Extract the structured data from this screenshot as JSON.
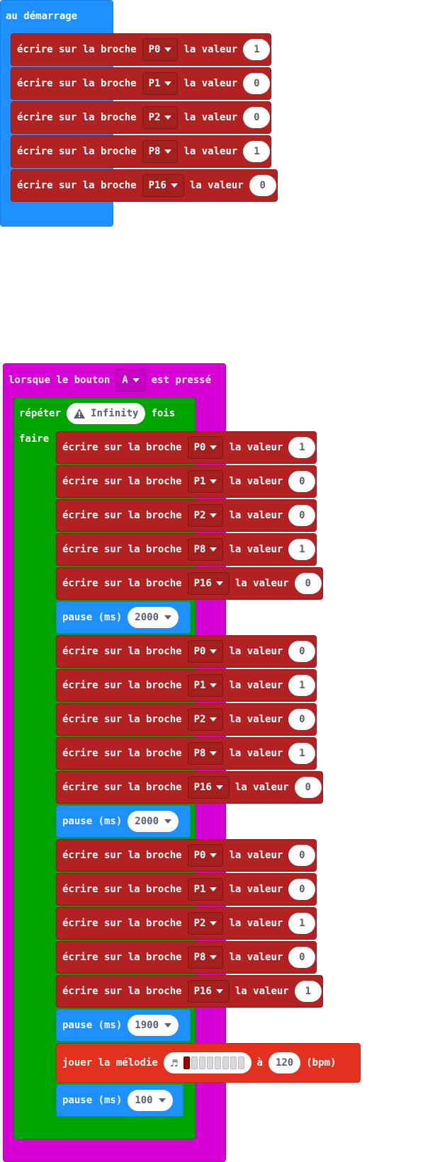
{
  "start_block": {
    "title": "au démarrage",
    "statements": [
      {
        "prefix": "écrire sur la broche",
        "pin": "P0",
        "mid": "la valeur",
        "value": "1"
      },
      {
        "prefix": "écrire sur la broche",
        "pin": "P1",
        "mid": "la valeur",
        "value": "0"
      },
      {
        "prefix": "écrire sur la broche",
        "pin": "P2",
        "mid": "la valeur",
        "value": "0"
      },
      {
        "prefix": "écrire sur la broche",
        "pin": "P8",
        "mid": "la valeur",
        "value": "1"
      },
      {
        "prefix": "écrire sur la broche",
        "pin": "P16",
        "mid": "la valeur",
        "value": "0"
      }
    ]
  },
  "button_block": {
    "prefix": "lorsque le bouton",
    "button": "A",
    "suffix": "est pressé",
    "repeat": {
      "label": "répéter",
      "count": "Infinity",
      "suffix": "fois",
      "do_label": "faire",
      "statements": [
        {
          "prefix": "écrire sur la broche",
          "pin": "P0",
          "mid": "la valeur",
          "value": "1"
        },
        {
          "prefix": "écrire sur la broche",
          "pin": "P1",
          "mid": "la valeur",
          "value": "0"
        },
        {
          "prefix": "écrire sur la broche",
          "pin": "P2",
          "mid": "la valeur",
          "value": "0"
        },
        {
          "prefix": "écrire sur la broche",
          "pin": "P8",
          "mid": "la valeur",
          "value": "1"
        },
        {
          "prefix": "écrire sur la broche",
          "pin": "P16",
          "mid": "la valeur",
          "value": "0"
        },
        {
          "pause_label": "pause (ms)",
          "pause": "2000"
        },
        {
          "prefix": "écrire sur la broche",
          "pin": "P0",
          "mid": "la valeur",
          "value": "0"
        },
        {
          "prefix": "écrire sur la broche",
          "pin": "P1",
          "mid": "la valeur",
          "value": "1"
        },
        {
          "prefix": "écrire sur la broche",
          "pin": "P2",
          "mid": "la valeur",
          "value": "0"
        },
        {
          "prefix": "écrire sur la broche",
          "pin": "P8",
          "mid": "la valeur",
          "value": "1"
        },
        {
          "prefix": "écrire sur la broche",
          "pin": "P16",
          "mid": "la valeur",
          "value": "0"
        },
        {
          "pause_label": "pause (ms)",
          "pause": "2000"
        },
        {
          "prefix": "écrire sur la broche",
          "pin": "P0",
          "mid": "la valeur",
          "value": "0"
        },
        {
          "prefix": "écrire sur la broche",
          "pin": "P1",
          "mid": "la valeur",
          "value": "0"
        },
        {
          "prefix": "écrire sur la broche",
          "pin": "P2",
          "mid": "la valeur",
          "value": "1"
        },
        {
          "prefix": "écrire sur la broche",
          "pin": "P8",
          "mid": "la valeur",
          "value": "0"
        },
        {
          "prefix": "écrire sur la broche",
          "pin": "P16",
          "mid": "la valeur",
          "value": "1"
        },
        {
          "pause_label": "pause (ms)",
          "pause": "1900"
        },
        {
          "melody_label": "jouer la mélodie",
          "at": "à",
          "tempo": "120",
          "unit": "(bpm)"
        },
        {
          "pause_label": "pause (ms)",
          "pause": "100"
        }
      ]
    }
  },
  "colors": {
    "event_blue": "#1e90ff",
    "event_magenta": "#d400d4",
    "loop_green": "#00a400",
    "pins_red": "#b22222",
    "music_red": "#e2311e"
  },
  "icons": {
    "warning": "warning-icon",
    "music": "music-note-icon",
    "dropdown": "chevron-down-icon"
  }
}
